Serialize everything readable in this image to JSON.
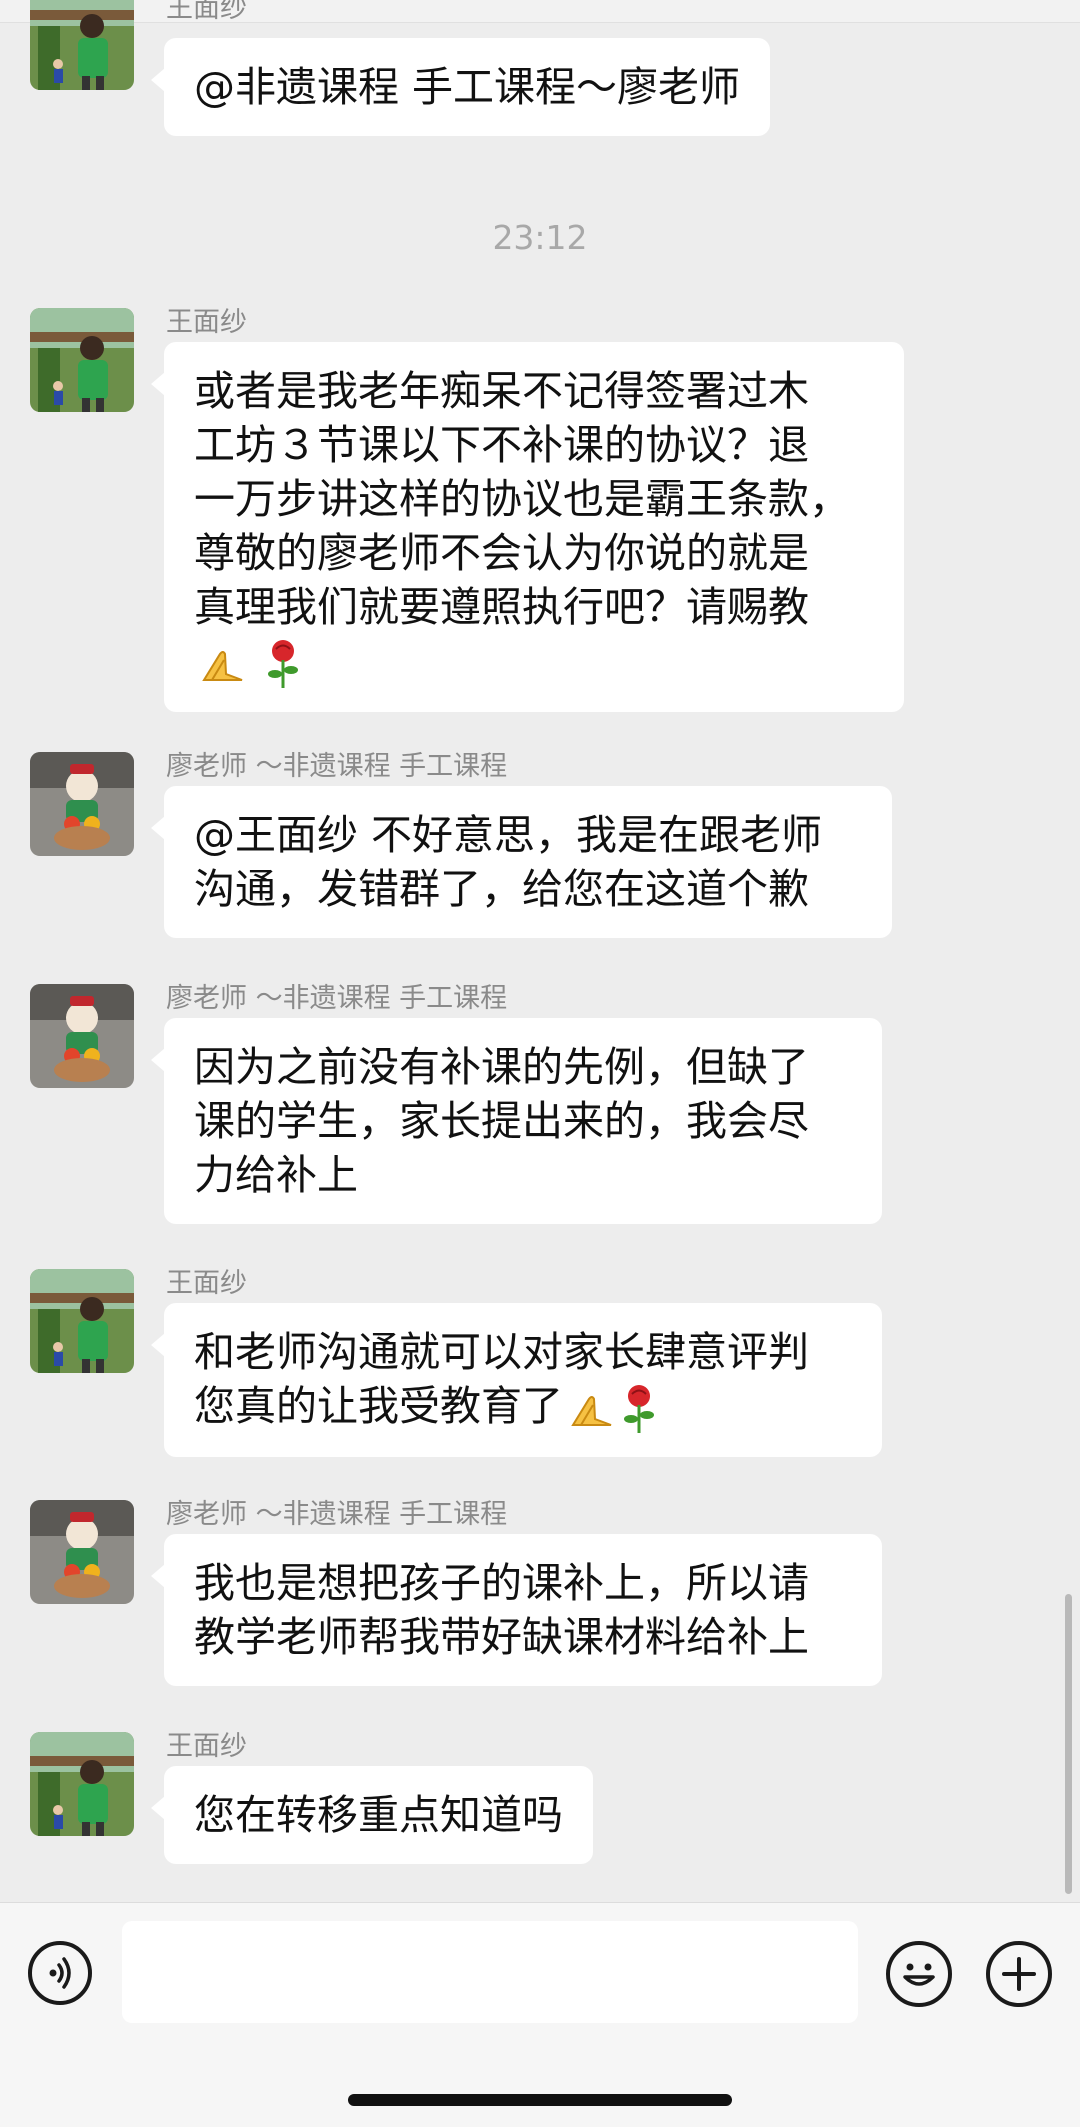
{
  "chat": {
    "time_divider": "23:12",
    "messages": [
      {
        "sender": "王面纱",
        "lines": [
          "@非遗课程 手工课程～廖老师"
        ],
        "emojis": []
      },
      {
        "sender": "王面纱",
        "lines": [
          "或者是我老年痴呆不记得签署过木",
          "工坊３节课以下不补课的协议？退",
          "一万步讲这样的协议也是霸王条款，",
          "尊敬的廖老师不会认为你说的就是",
          "真理我们就要遵照执行吧？请赐教"
        ],
        "emojis": [
          "praying-hands",
          "rose"
        ]
      },
      {
        "sender": "廖老师 ～非遗课程 手工课程",
        "lines": [
          "@王面纱 不好意思，我是在跟老师",
          "沟通，发错群了，给您在这道个歉"
        ],
        "emojis": []
      },
      {
        "sender": "廖老师 ～非遗课程 手工课程",
        "lines": [
          "因为之前没有补课的先例，但缺了",
          "课的学生，家长提出来的，我会尽",
          "力给补上"
        ],
        "emojis": []
      },
      {
        "sender": "王面纱",
        "lines": [
          "和老师沟通就可以对家长肆意评判",
          "您真的让我受教育了"
        ],
        "emojis": [
          "praying-hands",
          "rose"
        ]
      },
      {
        "sender": "廖老师 ～非遗课程 手工课程",
        "lines": [
          "我也是想把孩子的课补上，所以请",
          "教学老师帮我带好缺课材料给补上"
        ],
        "emojis": []
      },
      {
        "sender": "王面纱",
        "lines": [
          "您在转移重点知道吗"
        ],
        "emojis": []
      }
    ]
  },
  "input_bar": {
    "voice_icon": "voice-icon",
    "emoji_icon": "emoji-smiley-icon",
    "plus_icon": "plus-icon",
    "text_value": ""
  },
  "colors": {
    "background": "#ededed",
    "bubble": "#ffffff",
    "sender_text": "#8a8a8a"
  }
}
